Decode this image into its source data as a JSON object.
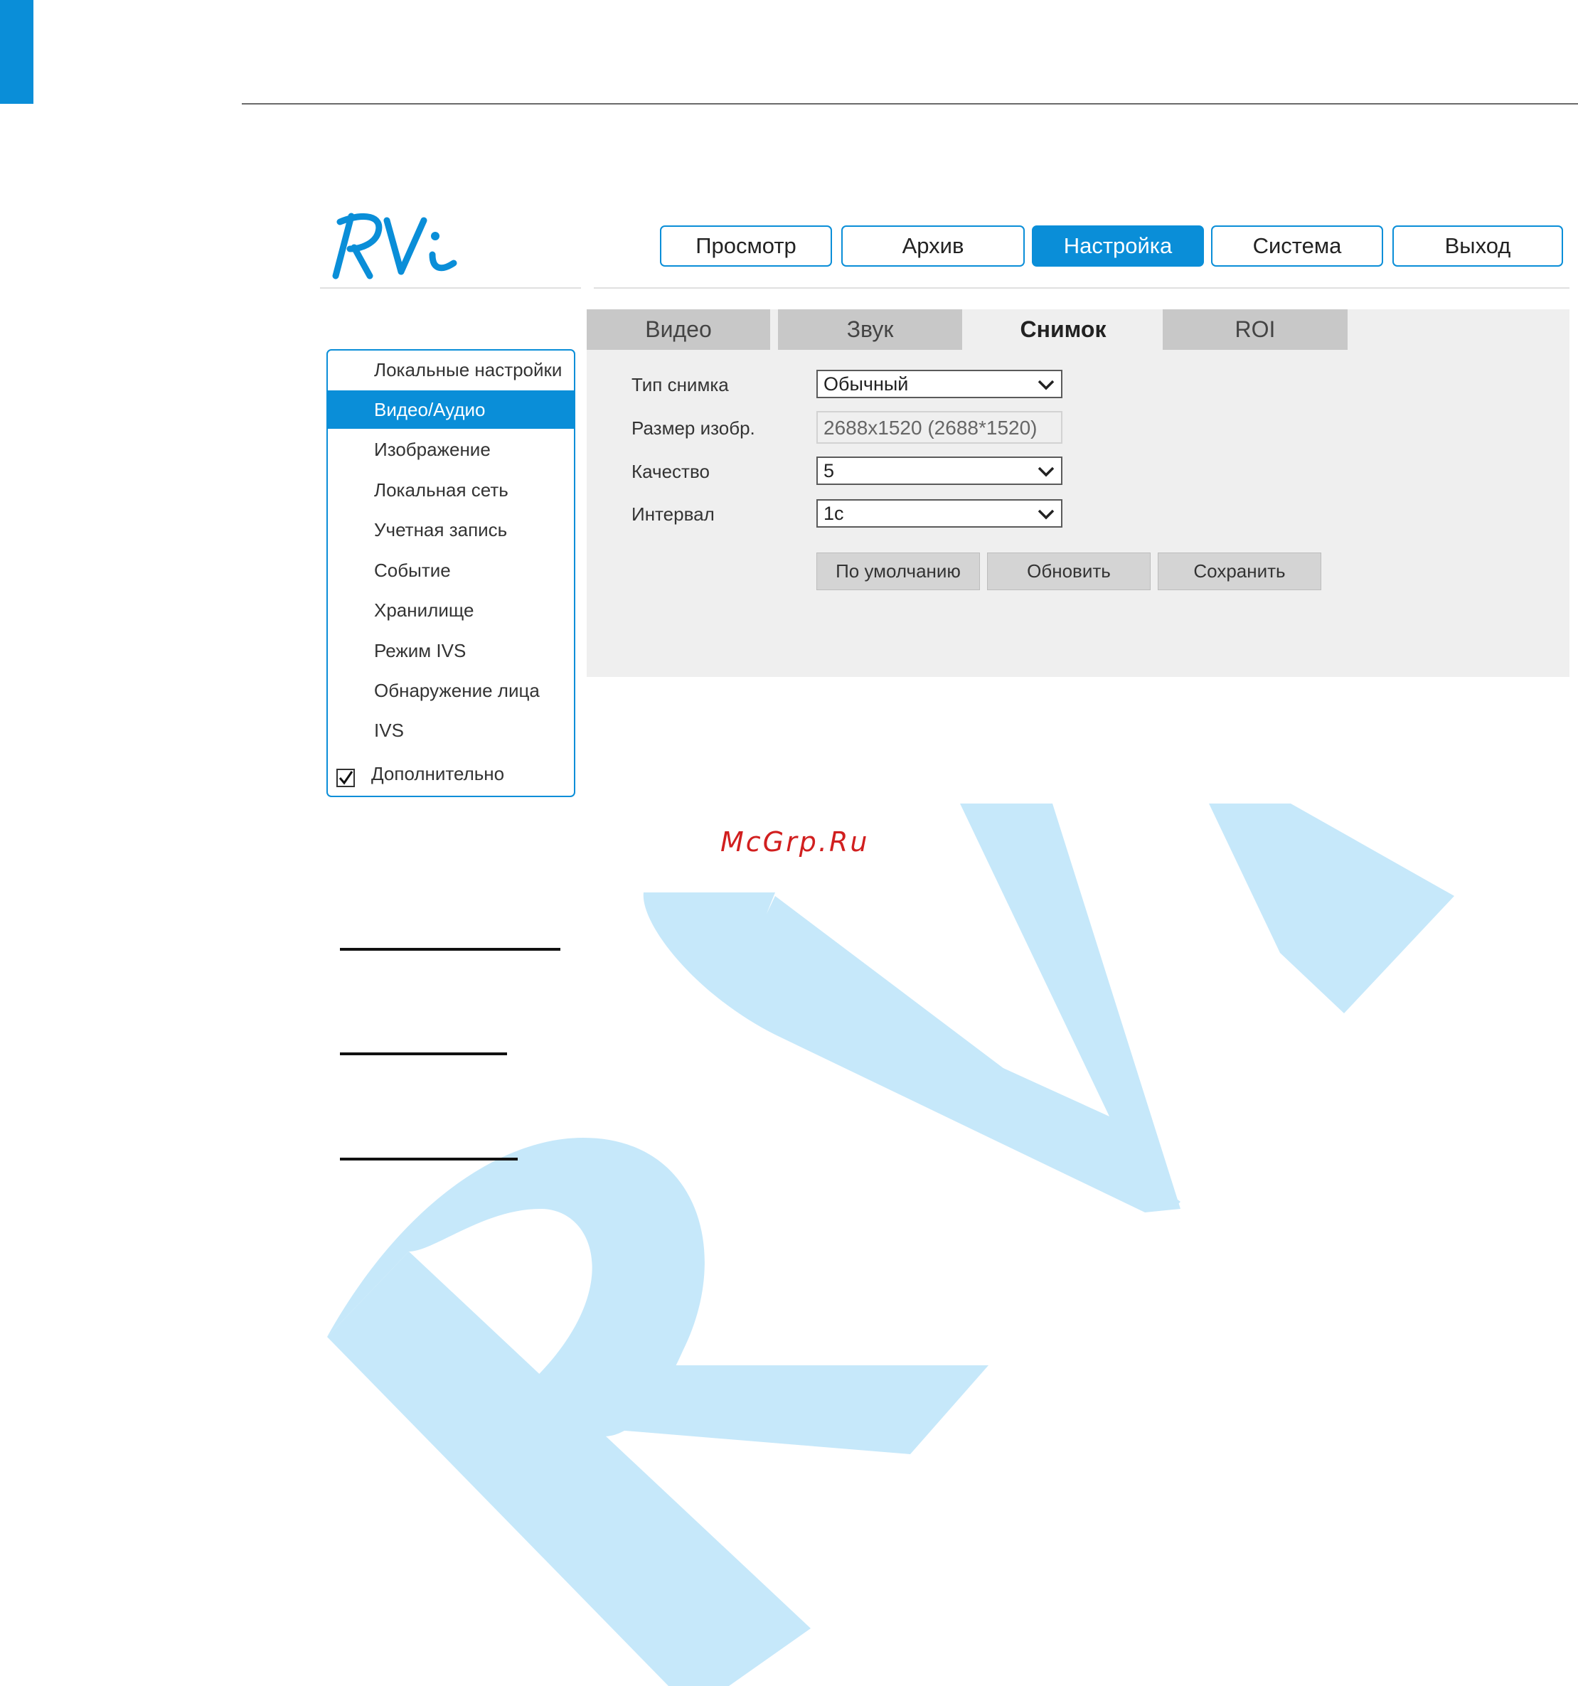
{
  "brand": {
    "logo_text": "RVi",
    "watermark_text": "RVi",
    "watermark_color": "#c6e8fa",
    "accent": "#0a8ed8"
  },
  "nav": {
    "items": [
      {
        "label": "Просмотр",
        "active": false
      },
      {
        "label": "Архив",
        "active": false
      },
      {
        "label": "Настройка",
        "active": true
      },
      {
        "label": "Система",
        "active": false
      },
      {
        "label": "Выход",
        "active": false
      }
    ]
  },
  "sidebar": {
    "items": [
      {
        "label": "Локальные настройки",
        "active": false
      },
      {
        "label": "Видео/Аудио",
        "active": true
      },
      {
        "label": "Изображение",
        "active": false
      },
      {
        "label": "Локальная сеть",
        "active": false
      },
      {
        "label": "Учетная запись",
        "active": false
      },
      {
        "label": "Событие",
        "active": false
      },
      {
        "label": "Хранилище",
        "active": false
      },
      {
        "label": "Режим IVS",
        "active": false
      },
      {
        "label": "Обнаружение лица",
        "active": false
      },
      {
        "label": "IVS",
        "active": false
      }
    ],
    "advanced": {
      "label": "Дополнительно",
      "checked": true
    }
  },
  "tabs": [
    {
      "label": "Видео",
      "active": false
    },
    {
      "label": "Звук",
      "active": false
    },
    {
      "label": "Снимок",
      "active": true
    },
    {
      "label": "ROI",
      "active": false
    }
  ],
  "form": {
    "snapshot_type": {
      "label": "Тип снимка",
      "value": "Обычный"
    },
    "image_size": {
      "label": "Размер изобр.",
      "value": "2688x1520 (2688*1520)"
    },
    "quality": {
      "label": "Качество",
      "value": "5"
    },
    "interval": {
      "label": "Интервал",
      "value": "1с"
    }
  },
  "actions": {
    "default_label": "По умолчанию",
    "refresh_label": "Обновить",
    "save_label": "Сохранить"
  },
  "footer": {
    "site_label": "McGrp.Ru"
  },
  "icons": {
    "chevron": "chevron-down-icon",
    "check": "checkmark-icon"
  }
}
